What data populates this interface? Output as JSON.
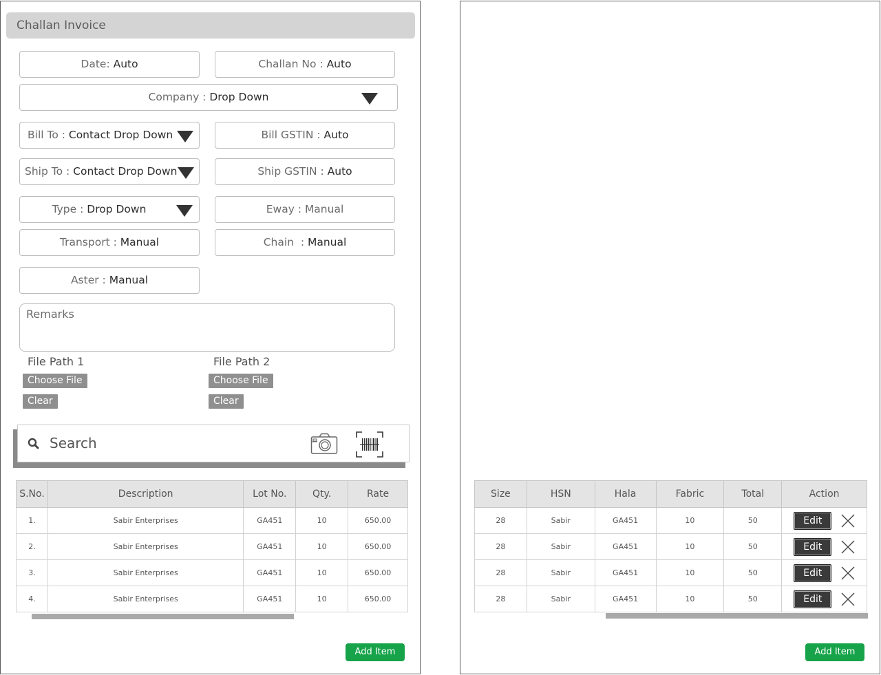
{
  "header": {
    "title": "Challan Invoice"
  },
  "fields": {
    "date": {
      "label": "Date: ",
      "value": "Auto"
    },
    "challan_no": {
      "label": "Challan No : ",
      "value": "Auto"
    },
    "company": {
      "label": "Company : ",
      "value": "Drop Down"
    },
    "bill_to": {
      "label": "Bill To : ",
      "value": "Contact Drop Down"
    },
    "bill_gstin": {
      "label": "Bill GSTIN : ",
      "value": "Auto"
    },
    "ship_to": {
      "label": "Ship To : ",
      "value": "Contact Drop Down"
    },
    "ship_gstin": {
      "label": "Ship GSTIN : ",
      "value": "Auto"
    },
    "type": {
      "label": "Type : ",
      "value": "Drop Down"
    },
    "eway": {
      "label": "Eway : ",
      "value": "Manual"
    },
    "transport": {
      "label": "Transport : ",
      "value": "Manual"
    },
    "chain": {
      "label": "Chain  : ",
      "value": "Manual"
    },
    "aster": {
      "label": "Aster : ",
      "value": "Manual"
    },
    "remarks_placeholder": "Remarks"
  },
  "files": {
    "file1": {
      "label": "File Path 1",
      "choose": "Choose File",
      "clear": "Clear"
    },
    "file2": {
      "label": "File Path 2",
      "choose": "Choose File",
      "clear": "Clear"
    }
  },
  "search": {
    "placeholder": "Search"
  },
  "left_table": {
    "headers": [
      "S.No.",
      "Description",
      "Lot No.",
      "Qty.",
      "Rate"
    ],
    "rows": [
      [
        "1.",
        "Sabir Enterprises",
        "GA451",
        "10",
        "650.00"
      ],
      [
        "2.",
        "Sabir Enterprises",
        "GA451",
        "10",
        "650.00"
      ],
      [
        "3.",
        "Sabir Enterprises",
        "GA451",
        "10",
        "650.00"
      ],
      [
        "4.",
        "Sabir Enterprises",
        "GA451",
        "10",
        "650.00"
      ]
    ]
  },
  "right_table": {
    "headers": [
      "Size",
      "HSN",
      "Hala",
      "Fabric",
      "Total",
      "Action"
    ],
    "rows": [
      [
        "28",
        "Sabir",
        "GA451",
        "10",
        "50"
      ],
      [
        "28",
        "Sabir",
        "GA451",
        "10",
        "50"
      ],
      [
        "28",
        "Sabir",
        "GA451",
        "10",
        "50"
      ],
      [
        "28",
        "Sabir",
        "GA451",
        "10",
        "50"
      ]
    ],
    "edit_label": "Edit"
  },
  "buttons": {
    "add_item": "Add Item"
  }
}
